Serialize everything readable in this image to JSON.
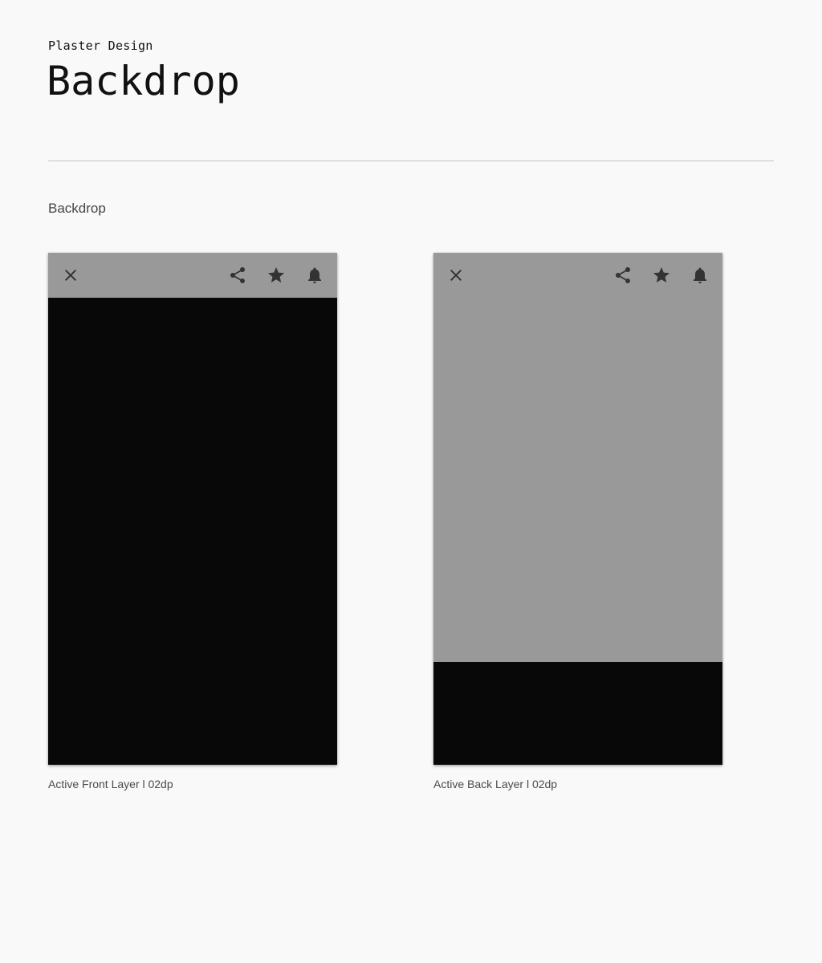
{
  "header": {
    "eyebrow": "Plaster Design",
    "title": "Backdrop"
  },
  "section": {
    "title": "Backdrop"
  },
  "examples": [
    {
      "caption": "Active Front Layer l 02dp",
      "appbar_icons": [
        "close-icon",
        "share-icon",
        "star-icon",
        "bell-icon"
      ]
    },
    {
      "caption": "Active Back Layer l 02dp",
      "appbar_icons": [
        "close-icon",
        "share-icon",
        "star-icon",
        "bell-icon"
      ]
    }
  ],
  "colors": {
    "page_background": "#f9f9f9",
    "back_layer": "#999999",
    "front_layer": "#080808",
    "icon": "#333333",
    "divider": "#c4c4c4"
  }
}
